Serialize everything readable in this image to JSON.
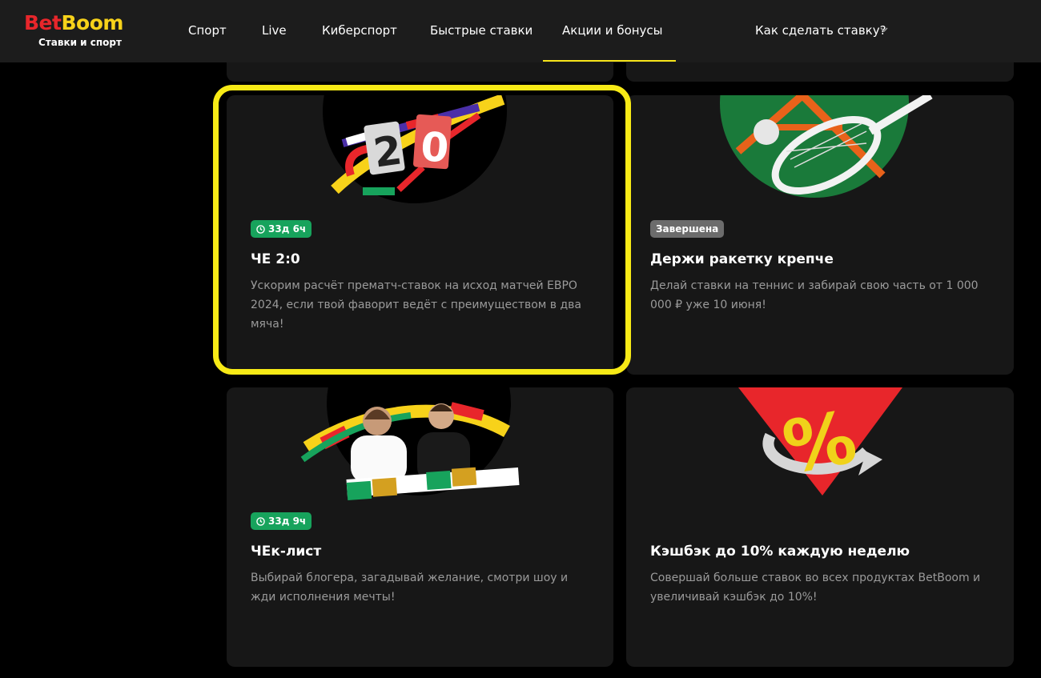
{
  "brand": {
    "name_part1": "Bet",
    "name_part2": "Boom",
    "tagline": "Ставки и спорт"
  },
  "nav": {
    "items": [
      "Спорт",
      "Live",
      "Киберспорт",
      "Быстрые ставки",
      "Акции и бонусы"
    ],
    "active": "Акции и бонусы",
    "help": "Как сделать ставку?"
  },
  "promos": [
    {
      "badge": "33д 6ч",
      "badge_type": "timer",
      "title": "ЧЕ 2:0",
      "description": "Ускорим расчёт прематч-ставок на исход матчей ЕВРО 2024, если твой фаворит ведёт с преимуществом в два мяча!",
      "art": "scoreboard-2-0",
      "highlighted": true
    },
    {
      "badge": "Завершена",
      "badge_type": "ended",
      "title": "Держи ракетку крепче",
      "description": "Делай ставки на теннис и забирай свою часть от 1 000 000 ₽ уже 10 июня!",
      "art": "tennis-racket"
    },
    {
      "badge": "33д 9ч",
      "badge_type": "timer",
      "title": "ЧЕк-лист",
      "description": "Выбирай блогера, загадывай желание, смотри шоу и жди исполнения мечты!",
      "art": "two-bloggers"
    },
    {
      "badge": "",
      "badge_type": "none",
      "title": "Кэшбэк до 10% каждую неделю",
      "description": "Совершай больше ставок во всех продуктах BetBoom и увеличивай кэшбэк до 10%!",
      "art": "percent-cashback"
    }
  ],
  "colors": {
    "accent": "#f7ea16",
    "timer_badge": "#17a35c",
    "ended_badge": "#6c6c6c",
    "card_bg": "#171717",
    "header_bg": "#1c1c1c",
    "brand_red": "#e8262b",
    "brand_yellow": "#f7d21a"
  }
}
